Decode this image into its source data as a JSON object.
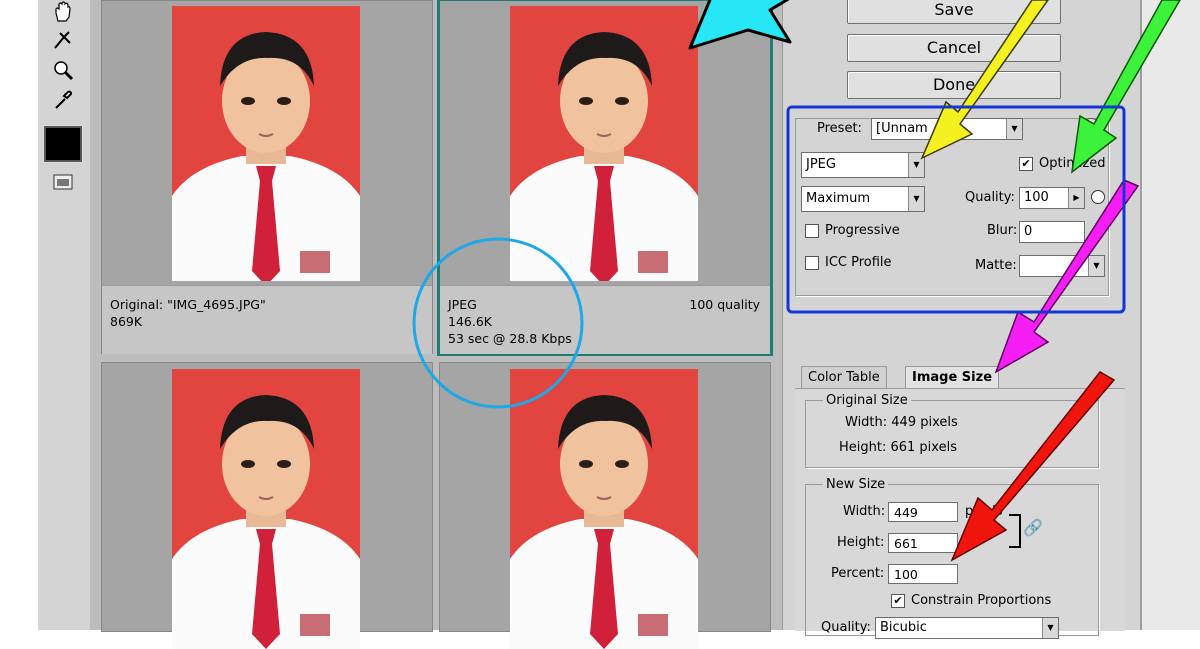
{
  "tools": {
    "hand": "hand-icon",
    "slice": "slice-select-icon",
    "zoom": "zoom-icon",
    "eyedropper": "eyedropper-icon",
    "color": "#000000",
    "preview_toggle": "preview-toggle-icon"
  },
  "panes": {
    "original": {
      "label": "Original: \"IMG_4695.JPG\"",
      "size": "869K"
    },
    "optimized": {
      "format": "JPEG",
      "quality": "100 quality",
      "size": "146.6K",
      "download": "53 sec @ 28.8 Kbps"
    }
  },
  "buttons": {
    "save": "Save",
    "cancel": "Cancel",
    "done": "Done"
  },
  "settings": {
    "preset_label": "Preset:",
    "preset_value": "[Unnam",
    "format": "JPEG",
    "compression": "Maximum",
    "optimized_label": "Optimized",
    "optimized_checked": true,
    "quality_label": "Quality:",
    "quality_value": "100",
    "progressive_label": "Progressive",
    "blur_label": "Blur:",
    "blur_value": "0",
    "icc_label": "ICC Profile",
    "matte_label": "Matte:"
  },
  "tabs": {
    "color_table": "Color Table",
    "image_size": "Image Size"
  },
  "original_size": {
    "title": "Original Size",
    "width": "Width: 449 pixels",
    "height": "Height: 661 pixels"
  },
  "new_size": {
    "title": "New Size",
    "width_label": "Width:",
    "width_value": "449",
    "width_unit": "pixels",
    "height_label": "Height:",
    "height_value": "661",
    "percent_label": "Percent:",
    "percent_value": "100",
    "constrain_label": "Constrain Proportions",
    "constrain_checked": true,
    "quality_label": "Quality:",
    "quality_value": "Bicubic"
  },
  "colors": {
    "cyan": "#27e6f5",
    "yellow": "#f5f020",
    "green": "#3cf23a",
    "magenta": "#f51ef5",
    "red": "#f2150e",
    "blue_box": "#1536d6",
    "circle": "#1ea8e6",
    "photo_bg": "#e2443f"
  }
}
